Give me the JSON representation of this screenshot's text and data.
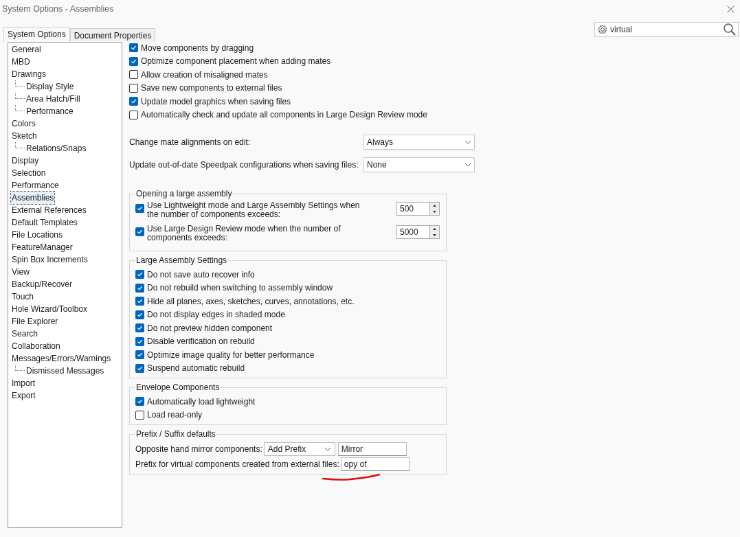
{
  "window": {
    "title": "System Options - Assemblies"
  },
  "tabs": [
    {
      "label": "System Options",
      "selected": true
    },
    {
      "label": "Document Properties",
      "selected": false
    }
  ],
  "search": {
    "value": "virtual"
  },
  "sidebar": {
    "items": [
      {
        "label": "General",
        "selected": false
      },
      {
        "label": "MBD",
        "selected": false
      },
      {
        "label": "Drawings",
        "selected": false,
        "children": [
          {
            "label": "Display Style",
            "selected": false
          },
          {
            "label": "Area Hatch/Fill",
            "selected": false
          },
          {
            "label": "Performance",
            "selected": false
          }
        ]
      },
      {
        "label": "Colors",
        "selected": false
      },
      {
        "label": "Sketch",
        "selected": false,
        "children": [
          {
            "label": "Relations/Snaps",
            "selected": false
          }
        ]
      },
      {
        "label": "Display",
        "selected": false
      },
      {
        "label": "Selection",
        "selected": false
      },
      {
        "label": "Performance",
        "selected": false
      },
      {
        "label": "Assemblies",
        "selected": true
      },
      {
        "label": "External References",
        "selected": false
      },
      {
        "label": "Default Templates",
        "selected": false
      },
      {
        "label": "File Locations",
        "selected": false
      },
      {
        "label": "FeatureManager",
        "selected": false
      },
      {
        "label": "Spin Box Increments",
        "selected": false
      },
      {
        "label": "View",
        "selected": false
      },
      {
        "label": "Backup/Recover",
        "selected": false
      },
      {
        "label": "Touch",
        "selected": false
      },
      {
        "label": "Hole Wizard/Toolbox",
        "selected": false
      },
      {
        "label": "File Explorer",
        "selected": false
      },
      {
        "label": "Search",
        "selected": false
      },
      {
        "label": "Collaboration",
        "selected": false
      },
      {
        "label": "Messages/Errors/Warnings",
        "selected": false,
        "children": [
          {
            "label": "Dismissed Messages",
            "selected": false
          }
        ]
      },
      {
        "label": "Import",
        "selected": false
      },
      {
        "label": "Export",
        "selected": false
      }
    ]
  },
  "options": [
    {
      "label": "Move components by dragging",
      "checked": true
    },
    {
      "label": "Optimize component placement when adding mates",
      "checked": true
    },
    {
      "label": "Allow creation of misaligned mates",
      "checked": false
    },
    {
      "label": "Save new components to external files",
      "checked": false
    },
    {
      "label": "Update model graphics when saving files",
      "checked": true
    },
    {
      "label": "Automatically check and update all components in Large Design Review mode",
      "checked": false
    }
  ],
  "dropdown_rows": [
    {
      "label": "Change mate alignments on edit:",
      "value": "Always"
    },
    {
      "label": "Update out-of-date Speedpak configurations when saving files:",
      "value": "None"
    }
  ],
  "groups": [
    {
      "title": "Opening a large assembly",
      "kind": "spin",
      "items": [
        {
          "label": "Use Lightweight mode and Large Assembly Settings when the number of components exceeds:",
          "checked": true,
          "value": "500"
        },
        {
          "label": "Use Large Design Review mode when the number of components exceeds:",
          "checked": true,
          "value": "5000"
        }
      ]
    },
    {
      "title": "Large Assembly Settings",
      "kind": "checks",
      "items": [
        {
          "label": "Do not save auto recover info",
          "checked": true
        },
        {
          "label": "Do not rebuild when switching to assembly window",
          "checked": true
        },
        {
          "label": "Hide all planes, axes, sketches, curves, annotations, etc.",
          "checked": true
        },
        {
          "label": "Do not display edges in shaded mode",
          "checked": true
        },
        {
          "label": "Do not preview hidden component",
          "checked": true
        },
        {
          "label": "Disable verification on rebuild",
          "checked": true
        },
        {
          "label": "Optimize image quality for better performance",
          "checked": true
        },
        {
          "label": "Suspend automatic rebuild",
          "checked": true
        }
      ]
    },
    {
      "title": "Envelope Components",
      "kind": "checks",
      "items": [
        {
          "label": "Automatically load lightweight",
          "checked": true
        },
        {
          "label": "Load read-only",
          "checked": false
        }
      ]
    },
    {
      "title": "Prefix / Suffix defaults",
      "kind": "fields",
      "items": [
        {
          "label": "Opposite hand mirror components:",
          "select": "Add Prefix",
          "value": "Mirror"
        },
        {
          "label": "Prefix for virtual components created from external files:",
          "value": "opy of"
        }
      ]
    }
  ]
}
